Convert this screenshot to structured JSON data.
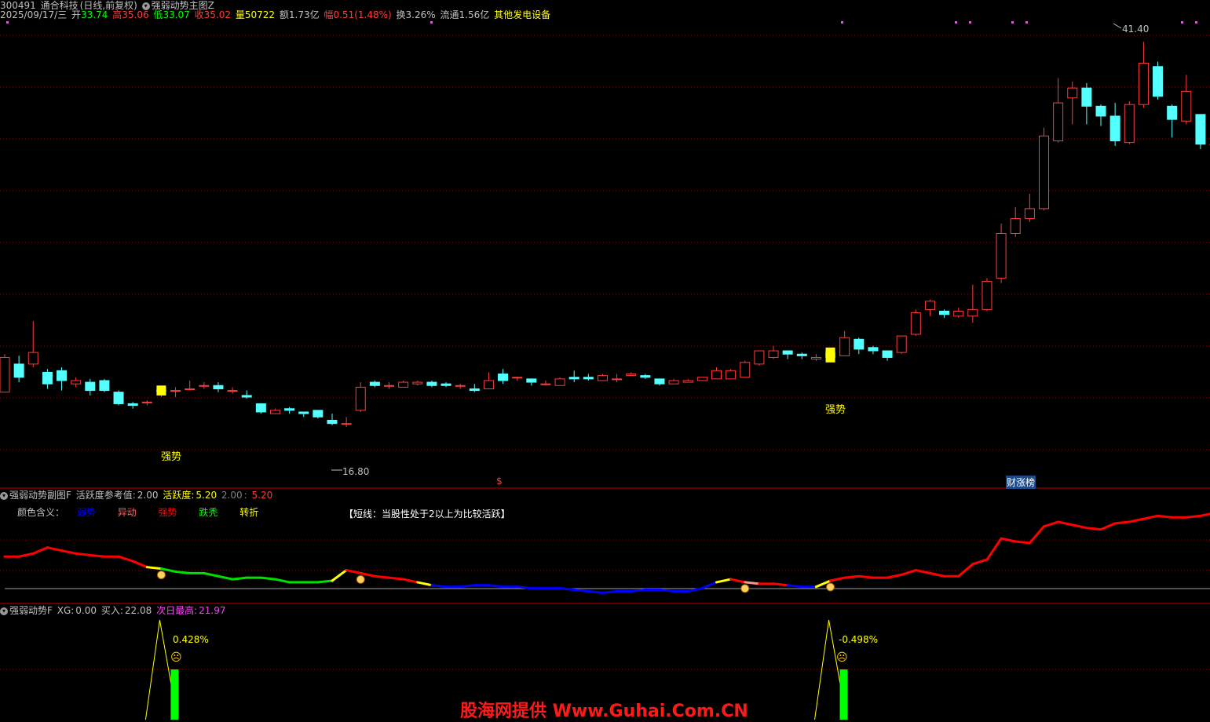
{
  "header": {
    "code": "300491",
    "name": "通合科技",
    "period": "(日线,前复权)",
    "indicator": "强弱动势主图Z",
    "date": "2025/09/17/三",
    "open_label": "开",
    "open": "33.74",
    "high_label": "高",
    "high": "35.06",
    "low_label": "低",
    "low": "33.07",
    "close_label": "收",
    "close": "35.02",
    "vol_label": "量",
    "vol": "50722",
    "amount_label": "额",
    "amount": "1.73亿",
    "change_label": "幅",
    "change": "0.51(1.48%)",
    "turnover_label": "换",
    "turnover": "3.26%",
    "float_label": "流通",
    "float": "1.56亿",
    "industry": "其他发电设备"
  },
  "main": {
    "max_label": "41.40",
    "min_label": "16.80",
    "strong_label_1": "强势",
    "strong_label_2": "强势",
    "dollar_mark": "$",
    "caizhangbang": "财涨榜"
  },
  "sub1": {
    "title": "强弱动势副图F",
    "ref_label": "活跃度参考值:",
    "ref_value": "2.00",
    "active_label": "活跃度:",
    "active_value": "5.20",
    "v2": "2.00",
    "v3": "5.20",
    "legend_title": "颜色含义：",
    "legend": [
      {
        "label": "弱势",
        "color": "#0000ff"
      },
      {
        "label": "异动",
        "color": "#ff6060"
      },
      {
        "label": "强势",
        "color": "#ff0000"
      },
      {
        "label": "跌秃",
        "color": "#00ff00"
      },
      {
        "label": "转折",
        "color": "#ffff00"
      }
    ],
    "note": "【短线：当股性处于2以上为比较活跃】"
  },
  "sub2": {
    "title": "强弱动势F",
    "xg_label": "XG:",
    "xg_value": "0.00",
    "buy_label": "买入:",
    "buy_value": "22.08",
    "next_label": "次日最高:",
    "next_value": "21.97",
    "pct1": "0.428%",
    "pct2": "-0.498%"
  },
  "watermark": "股海网提供 Www.Guhai.Com.CN",
  "colors": {
    "up": "#ff3b3b",
    "down": "#54ffff",
    "grid": "#8b0000",
    "signal": "#ffff00"
  },
  "chart_data": {
    "type": "candlestick",
    "ylim": [
      15.2,
      42.5
    ],
    "candles": [
      [
        20.2,
        22.3,
        20.2,
        22.5
      ],
      [
        21.9,
        21.1,
        20.8,
        22.4
      ],
      [
        21.9,
        22.6,
        21.7,
        24.5
      ],
      [
        21.4,
        20.7,
        20.4,
        21.6
      ],
      [
        21.5,
        20.9,
        20.3,
        21.7
      ],
      [
        20.7,
        20.9,
        20.5,
        21.1
      ],
      [
        20.8,
        20.3,
        20.0,
        21.0
      ],
      [
        20.9,
        20.3,
        20.2,
        21.0
      ],
      [
        20.2,
        19.5,
        19.4,
        20.3
      ],
      [
        19.5,
        19.4,
        19.2,
        19.6
      ],
      [
        19.6,
        19.6,
        19.4,
        19.7
      ],
      [
        20.3,
        20.3,
        19.9,
        20.5
      ],
      [
        20.3,
        20.3,
        19.9,
        20.5
      ],
      [
        20.4,
        20.4,
        20.3,
        20.9
      ],
      [
        20.6,
        20.6,
        20.4,
        20.8
      ],
      [
        20.6,
        20.4,
        20.2,
        20.8
      ],
      [
        20.3,
        20.3,
        20.1,
        20.5
      ],
      [
        20.0,
        19.9,
        19.8,
        20.3
      ],
      [
        19.5,
        19.0,
        18.9,
        19.5
      ],
      [
        18.9,
        19.1,
        18.9,
        19.2
      ],
      [
        19.2,
        19.1,
        18.9,
        19.3
      ],
      [
        19.0,
        18.9,
        18.7,
        19.0
      ],
      [
        19.1,
        18.7,
        18.6,
        19.1
      ],
      [
        18.5,
        18.3,
        18.2,
        18.9
      ],
      [
        18.3,
        18.3,
        18.1,
        18.7
      ],
      [
        19.1,
        20.5,
        19.0,
        20.8
      ],
      [
        20.8,
        20.6,
        20.5,
        20.9
      ],
      [
        20.6,
        20.6,
        20.4,
        20.8
      ],
      [
        20.5,
        20.8,
        20.5,
        20.9
      ],
      [
        20.7,
        20.8,
        20.6,
        20.9
      ],
      [
        20.8,
        20.6,
        20.5,
        20.9
      ],
      [
        20.7,
        20.6,
        20.5,
        20.8
      ],
      [
        20.6,
        20.6,
        20.4,
        20.7
      ],
      [
        20.4,
        20.3,
        20.2,
        20.7
      ],
      [
        20.4,
        20.9,
        20.4,
        21.4
      ],
      [
        21.3,
        20.9,
        20.7,
        21.6
      ],
      [
        21.1,
        21.1,
        20.9,
        21.1
      ],
      [
        21.0,
        20.8,
        20.6,
        21.0
      ],
      [
        20.7,
        20.7,
        20.6,
        20.9
      ],
      [
        20.6,
        21.0,
        20.6,
        21.1
      ],
      [
        21.1,
        21.0,
        20.8,
        21.5
      ],
      [
        21.1,
        21.0,
        20.9,
        21.3
      ],
      [
        20.9,
        21.2,
        20.9,
        21.3
      ],
      [
        21.0,
        21.0,
        20.8,
        21.3
      ],
      [
        21.2,
        21.3,
        21.2,
        21.4
      ],
      [
        21.2,
        21.1,
        21.0,
        21.3
      ],
      [
        21.0,
        20.7,
        20.6,
        21.0
      ],
      [
        20.7,
        20.9,
        20.7,
        21.0
      ],
      [
        20.8,
        20.9,
        20.8,
        21.0
      ],
      [
        20.9,
        21.1,
        20.9,
        21.1
      ],
      [
        21.0,
        21.5,
        21.0,
        21.7
      ],
      [
        21.0,
        21.5,
        21.2,
        21.6
      ],
      [
        21.1,
        22.0,
        21.1,
        22.1
      ],
      [
        21.9,
        22.7,
        21.8,
        22.7
      ],
      [
        22.3,
        22.7,
        22.2,
        23.0
      ],
      [
        22.7,
        22.5,
        22.2,
        22.7
      ],
      [
        22.5,
        22.4,
        22.2,
        22.6
      ],
      [
        22.2,
        22.3,
        22.1,
        22.5
      ],
      [
        22.3,
        22.6,
        22.0,
        22.6
      ],
      [
        22.4,
        23.5,
        22.4,
        23.9
      ],
      [
        23.4,
        22.8,
        22.5,
        23.5
      ],
      [
        22.9,
        22.7,
        22.5,
        23.0
      ],
      [
        22.7,
        22.3,
        22.1,
        22.7
      ],
      [
        22.6,
        23.6,
        22.5,
        23.6
      ],
      [
        23.7,
        25.0,
        23.6,
        25.2
      ],
      [
        25.2,
        25.7,
        24.8,
        25.8
      ],
      [
        25.1,
        24.9,
        24.7,
        25.2
      ],
      [
        24.8,
        25.1,
        24.7,
        25.3
      ],
      [
        24.8,
        25.2,
        24.4,
        26.7
      ],
      [
        25.2,
        26.9,
        25.1,
        27.1
      ],
      [
        27.1,
        29.8,
        26.8,
        30.4
      ],
      [
        29.8,
        30.7,
        29.6,
        31.4
      ],
      [
        30.7,
        31.3,
        30.5,
        32.2
      ],
      [
        31.3,
        35.7,
        31.2,
        36.2
      ],
      [
        35.4,
        37.7,
        35.3,
        39.2
      ],
      [
        38.0,
        38.6,
        36.4,
        39.0
      ],
      [
        38.6,
        37.5,
        36.4,
        38.9
      ],
      [
        37.5,
        36.9,
        36.3,
        37.6
      ],
      [
        36.9,
        35.4,
        35.1,
        37.7
      ],
      [
        35.3,
        37.6,
        35.2,
        37.8
      ],
      [
        37.6,
        40.1,
        37.4,
        41.4
      ],
      [
        39.9,
        38.1,
        37.9,
        40.2
      ],
      [
        37.5,
        36.7,
        35.6,
        37.6
      ],
      [
        36.6,
        38.4,
        36.4,
        39.4
      ],
      [
        37.0,
        35.2,
        34.9,
        37.0
      ],
      [
        35.2,
        35.2,
        35.0,
        35.9
      ],
      [
        35.1,
        35.5,
        34.8,
        35.9
      ],
      [
        34.7,
        35.2,
        34.3,
        35.8
      ]
    ],
    "strength_series": [
      2.4,
      2.4,
      2.6,
      3.0,
      2.8,
      2.6,
      2.5,
      2.4,
      2.4,
      2.1,
      1.7,
      1.6,
      1.4,
      1.3,
      1.3,
      1.1,
      0.9,
      1.0,
      1.0,
      0.9,
      0.7,
      0.7,
      0.7,
      0.8,
      1.5,
      1.3,
      1.1,
      1.0,
      0.9,
      0.7,
      0.5,
      0.4,
      0.4,
      0.5,
      0.5,
      0.4,
      0.4,
      0.3,
      0.3,
      0.3,
      0.2,
      0.1,
      0.0,
      0.1,
      0.1,
      0.2,
      0.2,
      0.1,
      0.1,
      0.3,
      0.7,
      0.9,
      0.7,
      0.6,
      0.6,
      0.5,
      0.4,
      0.4,
      0.8,
      1.0,
      1.1,
      1.0,
      1.0,
      1.2,
      1.5,
      1.3,
      1.1,
      1.1,
      1.9,
      2.2,
      3.6,
      3.4,
      3.3,
      4.4,
      4.7,
      4.5,
      4.3,
      4.2,
      4.6,
      4.7,
      4.9,
      5.1,
      5.0,
      5.0,
      5.1,
      5.3,
      5.0,
      4.7,
      4.5
    ],
    "strength_ylim": [
      -0.5,
      6.0
    ],
    "signal_idx": [
      11,
      58
    ],
    "sub1_marker_idx": [
      11,
      25,
      52,
      58
    ]
  }
}
